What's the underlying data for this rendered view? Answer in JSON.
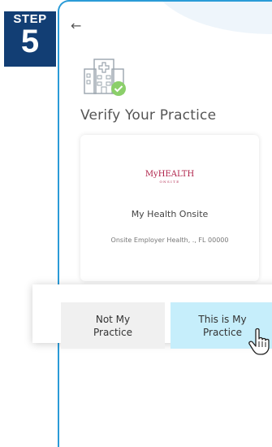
{
  "step": {
    "label": "STEP",
    "number": "5"
  },
  "header": {
    "back_icon": "back-arrow-icon"
  },
  "page": {
    "title": "Verify Your Practice",
    "icon": "hospital-check-icon"
  },
  "practice_card": {
    "logo": {
      "text": "MyHEALTH",
      "subtext": "ONSITE"
    },
    "name": "My Health Onsite",
    "address": "Onsite Employer Health, ., FL 00000"
  },
  "actions": {
    "not_my_practice": "Not My\nPractice",
    "this_is_my_practice": "This is My\nPractice"
  },
  "colors": {
    "step_badge": "#123e74",
    "frame_border": "#2a9bd7",
    "confirm_button": "#c6eefb",
    "decline_button": "#f0f0f0",
    "logo": "#b0234a",
    "check": "#8bcf6a"
  }
}
